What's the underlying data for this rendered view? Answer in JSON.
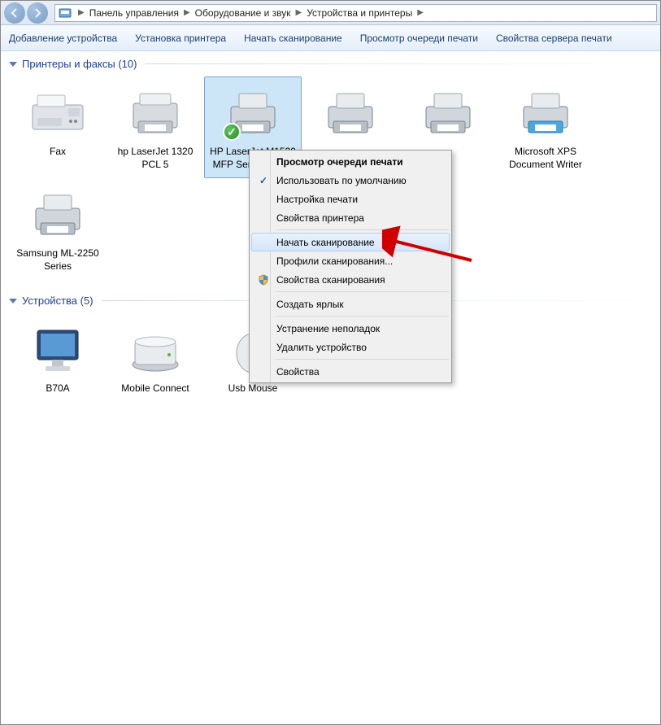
{
  "breadcrumb": {
    "parts": [
      "Панель управления",
      "Оборудование и звук",
      "Устройства и принтеры"
    ]
  },
  "toolbar": {
    "add_device": "Добавление устройства",
    "install_printer": "Установка принтера",
    "start_scan": "Начать сканирование",
    "print_queue": "Просмотр очереди печати",
    "server_props": "Свойства сервера печати"
  },
  "groups": {
    "printers": {
      "title": "Принтеры и факсы",
      "count": "(10)"
    },
    "devices": {
      "title": "Устройства",
      "count": "(5)"
    }
  },
  "printers": [
    {
      "label": "Fax"
    },
    {
      "label": "hp LaserJet 1320 PCL 5"
    },
    {
      "label": "HP LaserJet M1530 MFP Series PCL 6",
      "selected": true,
      "default": true
    },
    {
      "label": ""
    },
    {
      "label": ""
    },
    {
      "label": "Microsoft XPS Document Writer"
    },
    {
      "label": "Samsung ML-2250 Series"
    }
  ],
  "devices": [
    {
      "label": "B70A"
    },
    {
      "label": "Mobile Connect"
    },
    {
      "label": "Usb Mouse"
    }
  ],
  "context_menu": {
    "view_queue": "Просмотр очереди печати",
    "set_default": "Использовать по умолчанию",
    "print_prefs": "Настройка печати",
    "printer_props": "Свойства принтера",
    "start_scan": "Начать сканирование",
    "scan_profiles": "Профили сканирования...",
    "scan_props": "Свойства сканирования",
    "create_shortcut": "Создать ярлык",
    "troubleshoot": "Устранение неполадок",
    "remove_device": "Удалить устройство",
    "properties": "Свойства"
  }
}
